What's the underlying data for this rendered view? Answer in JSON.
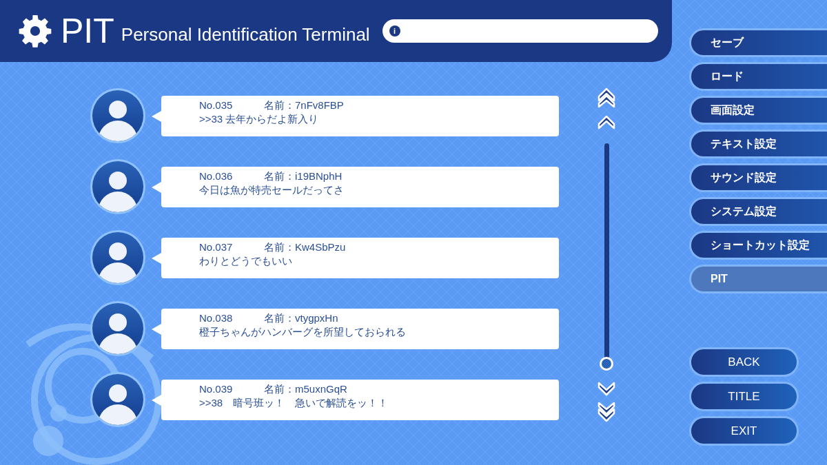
{
  "header": {
    "logo": "PIT",
    "subtitle": "Personal Identification Terminal",
    "info_field": {
      "icon_text": "i"
    }
  },
  "messages": [
    {
      "number": "No.035",
      "name": "名前：7nFv8FBP",
      "text": ">>33 去年からだよ新入り"
    },
    {
      "number": "No.036",
      "name": "名前：i19BNphH",
      "text": "今日は魚が特売セールだってさ"
    },
    {
      "number": "No.037",
      "name": "名前：Kw4SbPzu",
      "text": "わりとどうでもいい"
    },
    {
      "number": "No.038",
      "name": "名前：vtygpxHn",
      "text": "橙子ちゃんがハンバーグを所望しておられる"
    },
    {
      "number": "No.039",
      "name": "名前：m5uxnGqR",
      "text": ">>38　暗号班ッ！　急いで解読をッ！！"
    }
  ],
  "menu": [
    {
      "label": "セーブ",
      "selected": false
    },
    {
      "label": "ロード",
      "selected": false
    },
    {
      "label": "画面設定",
      "selected": false
    },
    {
      "label": "テキスト設定",
      "selected": false
    },
    {
      "label": "サウンド設定",
      "selected": false
    },
    {
      "label": "システム設定",
      "selected": false
    },
    {
      "label": "ショートカット設定",
      "selected": false
    },
    {
      "label": "PIT",
      "selected": true
    }
  ],
  "bottom_buttons": [
    "BACK",
    "TITLE",
    "EXIT"
  ]
}
